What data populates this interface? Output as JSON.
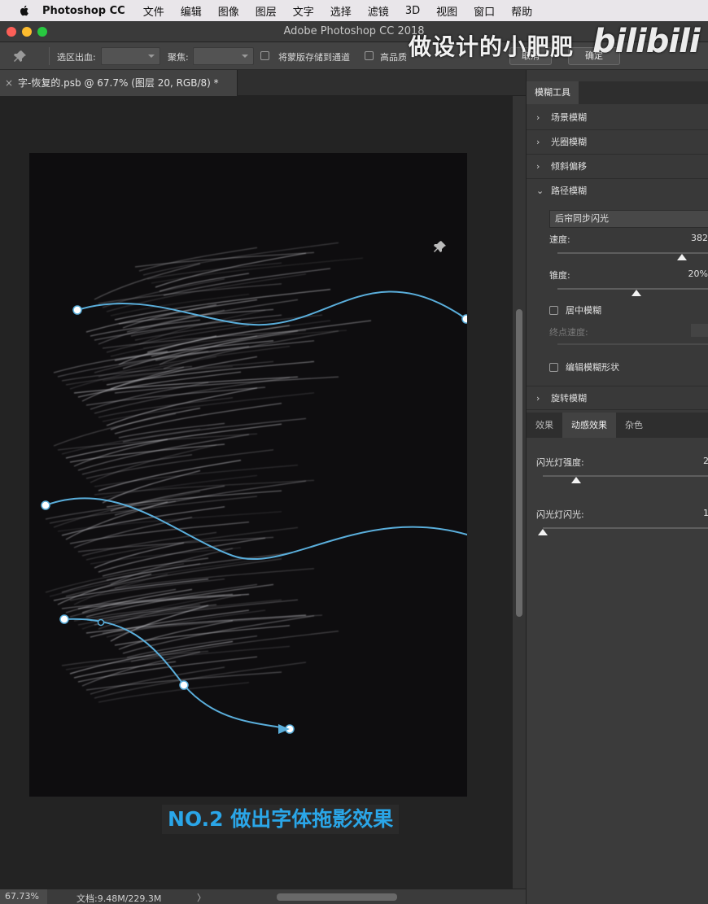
{
  "menubar": {
    "app_name": "Photoshop CC",
    "items": [
      "文件",
      "编辑",
      "图像",
      "图层",
      "文字",
      "选择",
      "滤镜",
      "3D",
      "视图",
      "窗口",
      "帮助"
    ]
  },
  "window": {
    "title": "Adobe Photoshop CC 2018"
  },
  "watermark": {
    "text": "做设计的小肥肥",
    "logo": "bilibili"
  },
  "options": {
    "selection_bleed_label": "选区出血:",
    "focus_label": "聚焦:",
    "save_mask_label": "将蒙版存储到通道",
    "high_quality_label": "高品质",
    "cancel_label": "取消",
    "ok_label": "确定"
  },
  "document": {
    "tab_close": "×",
    "tab_title": "字-恢复的.psb @ 67.7% (图层 20, RGB/8) *"
  },
  "canvas": {
    "caption": "NO.2 做出字体拖影效果",
    "path_color": "#5aaedb",
    "background": "#0e0d0f"
  },
  "status": {
    "zoom": "67.73%",
    "doc_size": "文档:9.48M/229.3M",
    "arrow": "〉"
  },
  "panel": {
    "tab": "模糊工具",
    "sections": [
      "场景模糊",
      "光圈模糊",
      "倾斜偏移",
      "路径模糊",
      "旋转模糊"
    ],
    "path_blur": {
      "mode": "后帘同步闪光",
      "speed_label": "速度:",
      "speed_value": "382",
      "speed_level": 0.82,
      "taper_label": "锥度:",
      "taper_value": "20%",
      "taper_level": 0.52,
      "center_blur_label": "居中模糊",
      "end_speed_label": "终点速度:",
      "edit_shape_label": "编辑模糊形状"
    },
    "tabs2": [
      "效果",
      "动感效果",
      "杂色"
    ],
    "motion": {
      "strobe_strength_label": "闪光灯强度:",
      "strobe_strength_value": "2",
      "strobe_strength_level": 0.2,
      "strobe_flash_label": "闪光灯闪光:",
      "strobe_flash_value": "1",
      "strobe_flash_level": 0.0
    }
  }
}
